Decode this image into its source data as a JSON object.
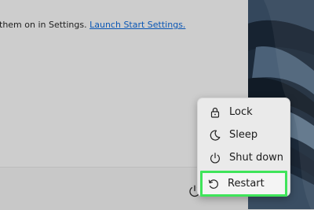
{
  "settings_info": {
    "prefix": "them on in Settings. ",
    "link": "Launch Start Settings."
  },
  "power_menu": {
    "items": [
      {
        "label": "Lock",
        "icon": "lock-icon"
      },
      {
        "label": "Sleep",
        "icon": "moon-icon"
      },
      {
        "label": "Shut down",
        "icon": "power-icon"
      },
      {
        "label": "Restart",
        "icon": "restart-icon"
      }
    ],
    "highlighted": "Restart",
    "highlight_color": "#3fe45a"
  },
  "footer": {
    "power_button_icon": "power-icon"
  }
}
